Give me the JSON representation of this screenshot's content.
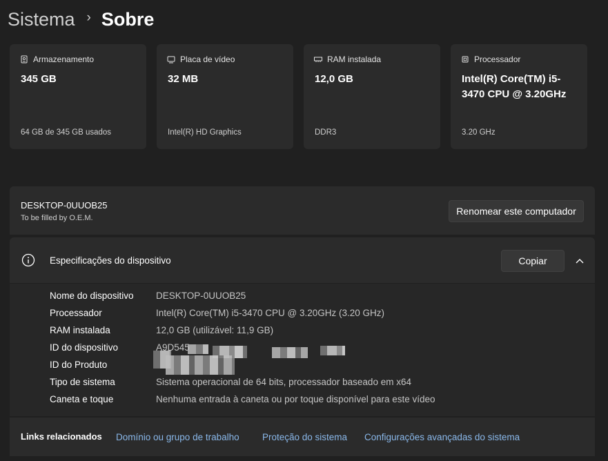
{
  "breadcrumb": {
    "parent": "Sistema",
    "separator": "›",
    "current": "Sobre"
  },
  "cards": [
    {
      "icon": "storage-icon",
      "label": "Armazenamento",
      "value": "345 GB",
      "sub": "64 GB de 345 GB usados"
    },
    {
      "icon": "gpu-icon",
      "label": "Placa de vídeo",
      "value": "32 MB",
      "sub": "Intel(R) HD Graphics"
    },
    {
      "icon": "ram-icon",
      "label": "RAM instalada",
      "value": "12,0 GB",
      "sub": "DDR3"
    },
    {
      "icon": "cpu-icon",
      "label": "Processador",
      "value": "Intel(R) Core(TM) i5-3470 CPU @ 3.20GHz",
      "sub": "3.20 GHz"
    }
  ],
  "computer": {
    "name": "DESKTOP-0UUOB25",
    "model": "To be filled by O.E.M.",
    "rename_label": "Renomear este computador"
  },
  "specs": {
    "title": "Especificações do dispositivo",
    "copy_label": "Copiar",
    "rows": [
      {
        "key": "Nome do dispositivo",
        "value": "DESKTOP-0UUOB25"
      },
      {
        "key": "Processador",
        "value": "Intel(R) Core(TM) i5-3470 CPU @ 3.20GHz (3.20 GHz)"
      },
      {
        "key": "RAM instalada",
        "value": "12,0 GB (utilizável: 11,9 GB)"
      },
      {
        "key": "ID do dispositivo",
        "value": "A9D545"
      },
      {
        "key": "ID do Produto",
        "value": ""
      },
      {
        "key": "Tipo de sistema",
        "value": "Sistema operacional de 64 bits, processador baseado em x64"
      },
      {
        "key": "Caneta e toque",
        "value": "Nenhuma entrada à caneta ou por toque disponível para este vídeo"
      }
    ]
  },
  "related": {
    "title": "Links relacionados",
    "links": [
      "Domínio ou grupo de trabalho",
      "Proteção do sistema",
      "Configurações avançadas do sistema"
    ]
  },
  "colors": {
    "background": "#202020",
    "card": "#2b2b2b",
    "link": "#8ab8ea"
  }
}
